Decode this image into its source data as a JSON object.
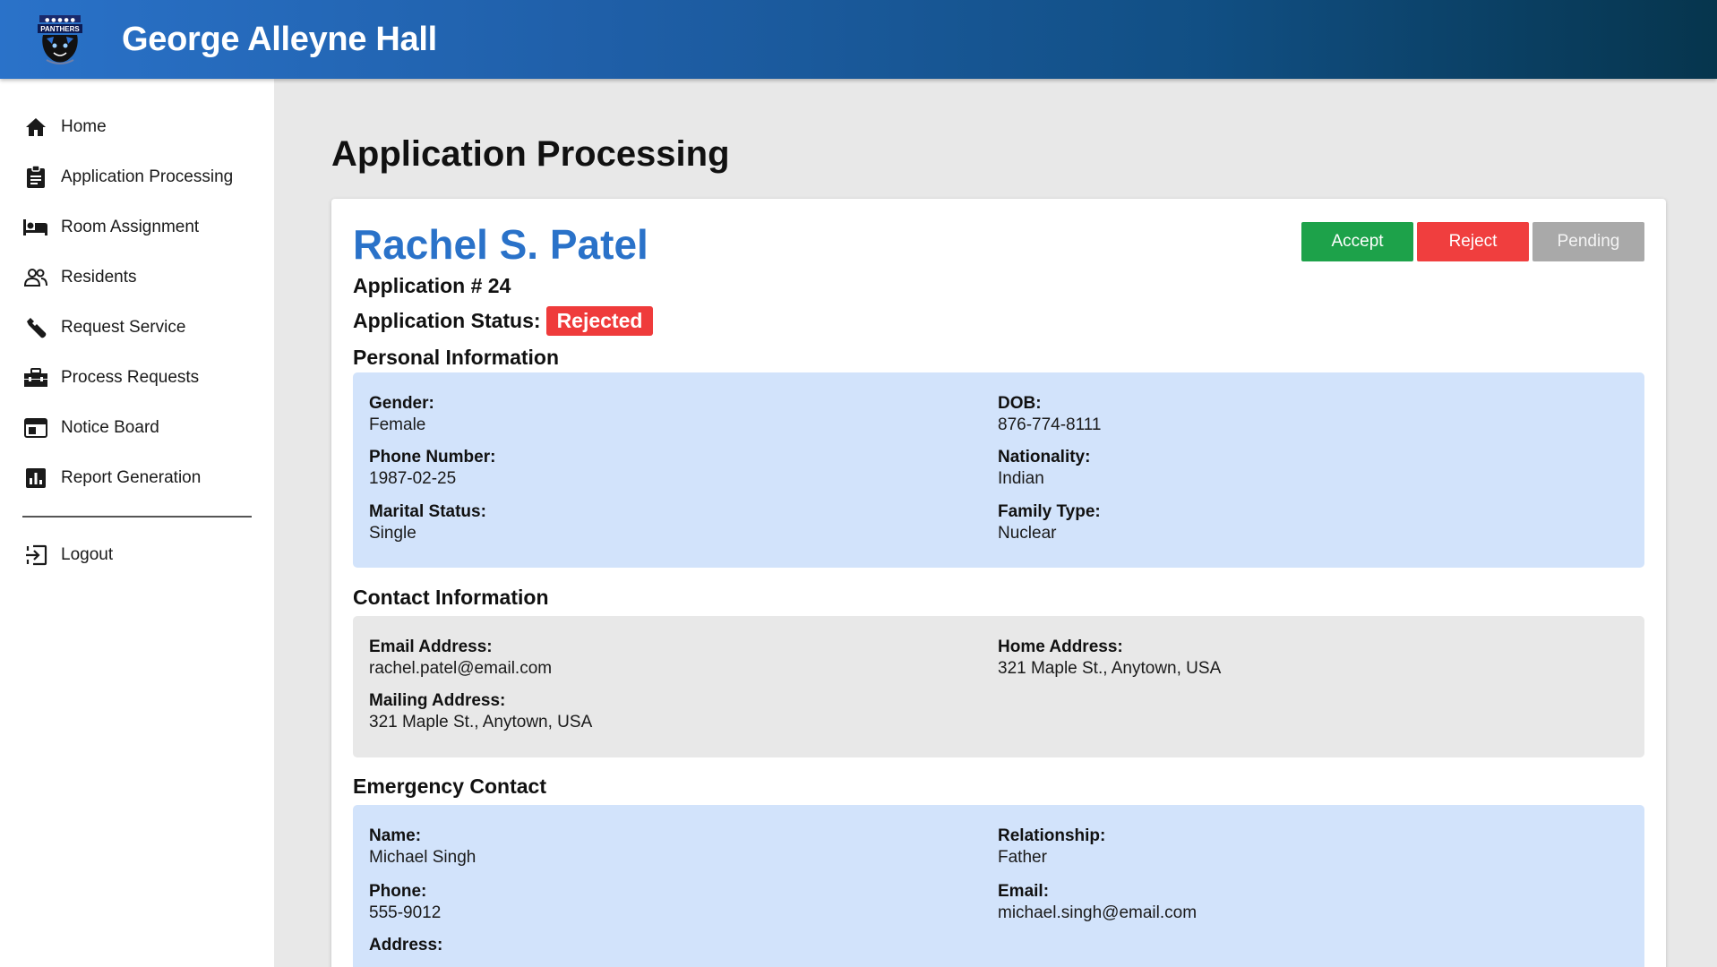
{
  "header": {
    "title": "George Alleyne Hall",
    "logo_icon": "panthers-logo-icon",
    "logo_text": "PANTHERS"
  },
  "sidebar": {
    "items": [
      {
        "label": "Home",
        "icon": "home-icon"
      },
      {
        "label": "Application Processing",
        "icon": "clipboard-icon"
      },
      {
        "label": "Room Assignment",
        "icon": "bed-icon"
      },
      {
        "label": "Residents",
        "icon": "people-icon"
      },
      {
        "label": "Request Service",
        "icon": "wrench-icon"
      },
      {
        "label": "Process Requests",
        "icon": "toolbox-icon"
      },
      {
        "label": "Notice Board",
        "icon": "board-icon"
      },
      {
        "label": "Report Generation",
        "icon": "chart-icon"
      }
    ],
    "logout": {
      "label": "Logout",
      "icon": "logout-icon"
    }
  },
  "page": {
    "title": "Application Processing"
  },
  "application": {
    "applicant_name": "Rachel S. Patel",
    "number_text": "Application # 24",
    "status_label": "Application Status:",
    "status": "Rejected",
    "status_color": "#ef3b3b",
    "actions": {
      "accept": "Accept",
      "reject": "Reject",
      "pending": "Pending"
    }
  },
  "personal": {
    "title": "Personal Information",
    "gender": {
      "label": "Gender:",
      "value": "Female"
    },
    "dob": {
      "label": "DOB:",
      "value": "876-774-8111"
    },
    "phone": {
      "label": "Phone Number:",
      "value": "1987-02-25"
    },
    "nationality": {
      "label": "Nationality:",
      "value": "Indian"
    },
    "marital": {
      "label": "Marital Status:",
      "value": "Single"
    },
    "family": {
      "label": "Family Type:",
      "value": "Nuclear"
    }
  },
  "contact": {
    "title": "Contact Information",
    "email": {
      "label": "Email Address:",
      "value": "rachel.patel@email.com"
    },
    "home": {
      "label": "Home Address:",
      "value": "321 Maple St., Anytown, USA"
    },
    "mailing": {
      "label": "Mailing Address:",
      "value": "321 Maple St., Anytown, USA"
    }
  },
  "emergency": {
    "title": "Emergency Contact",
    "name": {
      "label": "Name:",
      "value": "Michael Singh"
    },
    "relationship": {
      "label": "Relationship:",
      "value": "Father"
    },
    "phone": {
      "label": "Phone:",
      "value": "555-9012"
    },
    "email": {
      "label": "Email:",
      "value": "michael.singh@email.com"
    },
    "address": {
      "label": "Address:"
    }
  },
  "colors": {
    "header_start": "#2a72c9",
    "header_end": "#06354d",
    "accent": "#2a72c9",
    "accept": "#1da24a",
    "reject": "#f03e3e",
    "pending": "#a9a9a9",
    "info_blue": "#d2e3fb",
    "info_grey": "#e8e8e8"
  }
}
